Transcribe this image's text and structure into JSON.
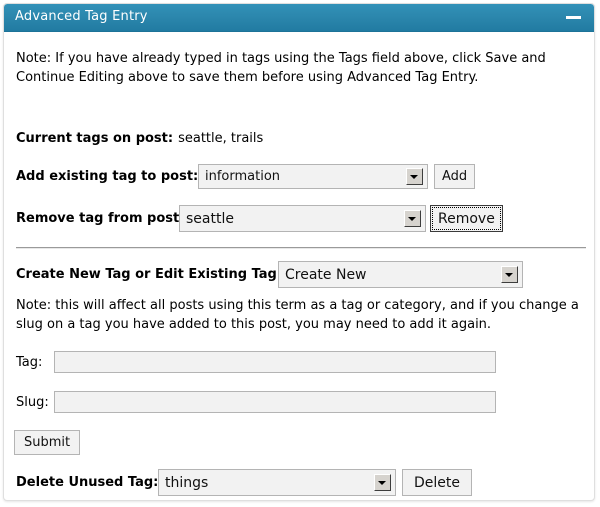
{
  "panel": {
    "title": "Advanced Tag Entry",
    "minimize_icon": "minimize-icon"
  },
  "notes": {
    "note_top": "Note: If you have already typed in tags using the Tags field above, click Save and Continue Editing above to save them before using Advanced Tag Entry.",
    "note_middle": "Note: this will affect all posts using this term as a tag or category, and if you change a slug on a tag you have added to this post, you may need to add it again."
  },
  "current_tags": {
    "label": "Current tags on post:",
    "value": "seattle, trails"
  },
  "add_existing": {
    "label": "Add existing tag to post:",
    "selected": "information",
    "button": "Add"
  },
  "remove_tag": {
    "label": "Remove tag from post:",
    "selected": "seattle",
    "button": "Remove"
  },
  "create_or_edit": {
    "label": "Create New Tag or Edit Existing Tag",
    "selected": "Create New"
  },
  "tag_field": {
    "label": "Tag:",
    "value": "",
    "placeholder": ""
  },
  "slug_field": {
    "label": "Slug:",
    "value": "",
    "placeholder": ""
  },
  "submit": {
    "button": "Submit"
  },
  "delete_unused": {
    "label": "Delete Unused Tag:",
    "selected": "things",
    "button": "Delete"
  },
  "colors": {
    "header_blue_top": "#3291b8",
    "header_blue_bottom": "#217ba2",
    "panel_border": "#dfdfdf",
    "control_bg": "#f2f2f2",
    "control_border": "#b4b4b4",
    "divider": "#9a9a9a"
  }
}
